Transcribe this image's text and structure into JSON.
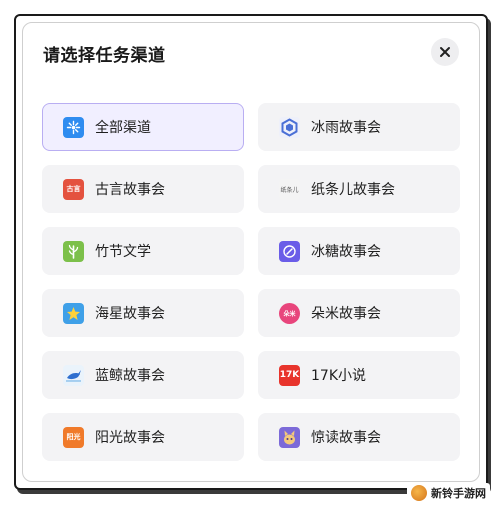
{
  "dialog": {
    "title": "请选择任务渠道",
    "close_icon": "close-icon"
  },
  "channels": [
    {
      "label": "全部渠道",
      "icon": "all-channels-icon",
      "icon_color": "#2f8cf0",
      "selected": true
    },
    {
      "label": "冰雨故事会",
      "icon": "bingyu-logo-icon",
      "icon_color": "#4a6fd6",
      "selected": false
    },
    {
      "label": "古言故事会",
      "icon": "guyan-logo-icon",
      "icon_color": "#e4523f",
      "icon_text": "古言",
      "selected": false
    },
    {
      "label": "纸条儿故事会",
      "icon": "zhitiaoer-logo-icon",
      "icon_color": "#f4f4f4",
      "icon_text": "纸条儿",
      "selected": false
    },
    {
      "label": "竹节文学",
      "icon": "zhujie-logo-icon",
      "icon_color": "#7cc04a",
      "selected": false
    },
    {
      "label": "冰糖故事会",
      "icon": "bingtang-logo-icon",
      "icon_color": "#6a5de8",
      "selected": false
    },
    {
      "label": "海星故事会",
      "icon": "haixing-logo-icon",
      "icon_color": "#3fa0e8",
      "selected": false
    },
    {
      "label": "朵米故事会",
      "icon": "duomi-logo-icon",
      "icon_color": "#e8457c",
      "icon_text": "朵米",
      "selected": false
    },
    {
      "label": "蓝鲸故事会",
      "icon": "lanjing-logo-icon",
      "icon_color": "#eaf3fb",
      "selected": false
    },
    {
      "label": "17K小说",
      "icon": "17k-logo-icon",
      "icon_color": "#e8342c",
      "icon_text": "17K",
      "selected": false
    },
    {
      "label": "阳光故事会",
      "icon": "yangguang-logo-icon",
      "icon_color": "#f07a2a",
      "icon_text": "阳光",
      "selected": false
    },
    {
      "label": "惊读故事会",
      "icon": "jingdu-logo-icon",
      "icon_color": "#7c6ad8",
      "selected": false
    }
  ],
  "watermark": {
    "text": "新铃手游网",
    "icon": "watermark-logo-icon"
  }
}
